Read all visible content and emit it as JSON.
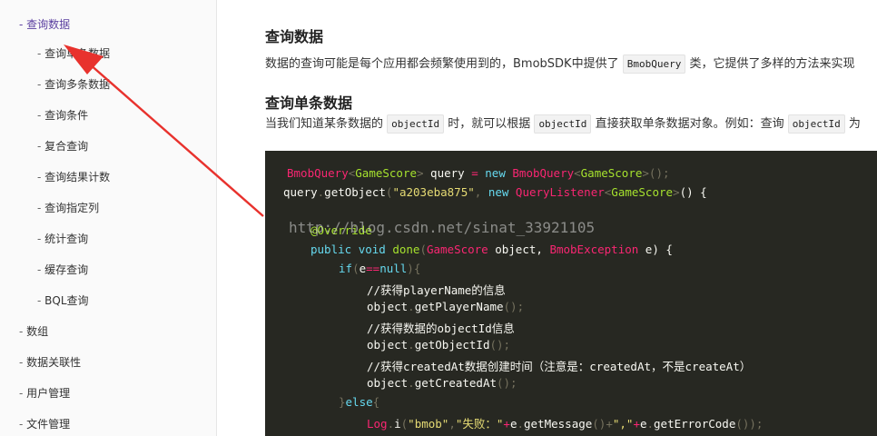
{
  "sidebar": {
    "items": [
      {
        "dash": "-",
        "label": "查询数据",
        "active": true
      },
      {
        "dash": "-",
        "label": "查询单条数据"
      },
      {
        "dash": "-",
        "label": "查询多条数据"
      },
      {
        "dash": "-",
        "label": "查询条件"
      },
      {
        "dash": "-",
        "label": "复合查询"
      },
      {
        "dash": "-",
        "label": "查询结果计数"
      },
      {
        "dash": "-",
        "label": "查询指定列"
      },
      {
        "dash": "-",
        "label": "统计查询"
      },
      {
        "dash": "-",
        "label": "缓存查询"
      },
      {
        "dash": "-",
        "label": "BQL查询"
      },
      {
        "dash": "-",
        "label": "数组"
      },
      {
        "dash": "-",
        "label": "数据关联性"
      },
      {
        "dash": "-",
        "label": "用户管理"
      },
      {
        "dash": "-",
        "label": "文件管理"
      }
    ]
  },
  "main": {
    "heading1": "查询数据",
    "intro_before": "数据的查询可能是每个应用都会频繁使用到的，BmobSDK中提供了",
    "intro_code": "BmobQuery",
    "intro_after": "类，它提供了多样的方法来实现",
    "heading2": "查询单条数据",
    "p2_a": "当我们知道某条数据的",
    "p2_code1": "objectId",
    "p2_b": "时，就可以根据",
    "p2_code2": "objectId",
    "p2_c": "直接获取单条数据对象。例如：查询",
    "p2_code3": "objectId",
    "p2_d": "为"
  },
  "code": {
    "l1": {
      "a": "BmobQuery",
      "b": "<",
      "c": "GameScore",
      "d": ">",
      "e": " query ",
      "f": "=",
      "g": " new ",
      "h": "BmobQuery",
      "i": "<",
      "j": "GameScore",
      "k": ">",
      "l": "();"
    },
    "l2": {
      "a": "query",
      "b": ".",
      "c": "getObject",
      "d": "(",
      "e": "\"a203eba875\"",
      "f": ", ",
      "g": "new ",
      "h": "QueryListener",
      "i": "<",
      "j": "GameScore",
      "k": ">",
      "l": "() {"
    },
    "l3": {
      "a": "@Override"
    },
    "l4": {
      "a": "public ",
      "b": "void ",
      "c": "done",
      "d": "(",
      "e": "GameScore",
      "f": " object, ",
      "g": "BmobException",
      "h": " e) {"
    },
    "l5": {
      "a": "if",
      "b": "(",
      "c": "e",
      "d": "==",
      "e": "null",
      "f": "){"
    },
    "l6": {
      "a": "//获得playerName的信息"
    },
    "l7": {
      "a": "object",
      "b": ".",
      "c": "getPlayerName",
      "d": "();"
    },
    "l8": {
      "a": "//获得数据的objectId信息"
    },
    "l9": {
      "a": "object",
      "b": ".",
      "c": "getObjectId",
      "d": "();"
    },
    "l10": {
      "a": "//获得createdAt数据创建时间（注意是：createdAt，不是createAt）"
    },
    "l11": {
      "a": "object",
      "b": ".",
      "c": "getCreatedAt",
      "d": "();"
    },
    "l12": {
      "a": "}",
      "b": "else",
      "c": "{"
    },
    "l13": {
      "a": "Log",
      "b": ".",
      "c": "i",
      "d": "(",
      "e": "\"bmob\"",
      "f": ",",
      "g": "\"失败：\"",
      "h": "+",
      "i": "e",
      "j": ".",
      "k": "getMessage",
      "l": "()+",
      "m": "\",\"",
      "n": "+",
      "o": "e",
      "p": ".",
      "q": "getErrorCode",
      "r": "());"
    }
  },
  "watermark": "http://blog.csdn.net/sinat_33921105",
  "colors": {
    "arrow": "#e8322d",
    "active_nav": "#5b3fa0",
    "code_bg": "#272822"
  }
}
